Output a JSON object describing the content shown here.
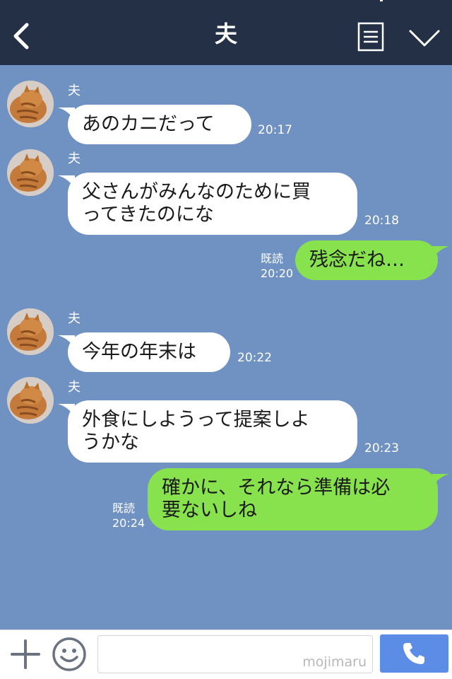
{
  "header": {
    "title": "夫",
    "back_icon": "chevron-left-icon",
    "menu_icon": "menu-icon",
    "collapse_icon": "chevron-down-icon"
  },
  "messages": [
    {
      "sender": "夫",
      "text": "あのカニだって",
      "time": "20:17"
    },
    {
      "sender": "夫",
      "lines": [
        "父さんがみんなのために買",
        "ってきたのにな"
      ],
      "time": "20:18"
    },
    {
      "read": "既読",
      "time": "20:20",
      "text": "残念だね…"
    },
    {
      "sender": "夫",
      "text": "今年の年末は",
      "time": "20:22"
    },
    {
      "sender": "夫",
      "lines": [
        "外食にしようって提案しよ",
        "うかな"
      ],
      "time": "20:23"
    },
    {
      "read": "既読",
      "time": "20:24",
      "lines": [
        "確かに、それなら準備は必",
        "要ないしね"
      ]
    }
  ],
  "input_bar": {
    "watermark": "mojimaru",
    "plus_icon": "plus-icon",
    "emoji_icon": "smile-icon",
    "call_icon": "phone-icon"
  },
  "colors": {
    "header": "#243045",
    "background": "#7092c3",
    "incoming_bubble": "#ffffff",
    "outgoing_bubble": "#87e24e",
    "call_button": "#5b8de6"
  }
}
